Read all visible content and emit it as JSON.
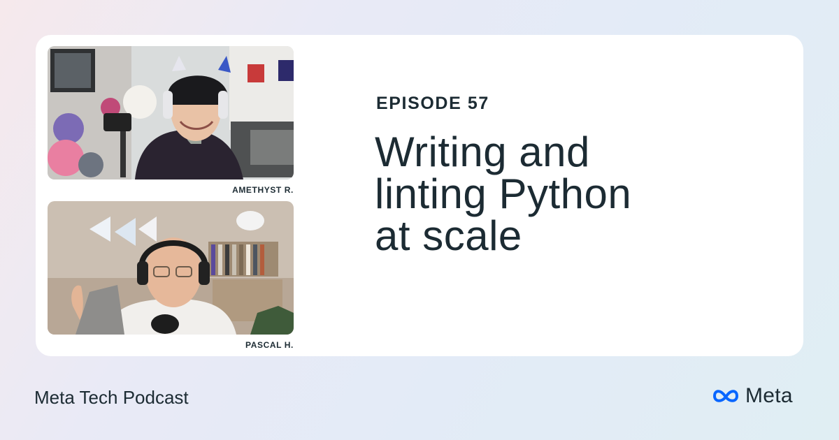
{
  "episode": {
    "label": "EPISODE 57",
    "title_lines": [
      "Writing and",
      "linting Python",
      "at scale"
    ]
  },
  "guests": [
    {
      "name": "AMETHYST R."
    },
    {
      "name": "PASCAL H."
    }
  ],
  "footer": {
    "show_name": "Meta Tech Podcast",
    "brand": "Meta"
  },
  "colors": {
    "text": "#1c2b33",
    "card": "#ffffff",
    "brand_blue": "#0866ff"
  },
  "icons": {
    "brand_logo": "meta-infinity-logo-icon"
  }
}
